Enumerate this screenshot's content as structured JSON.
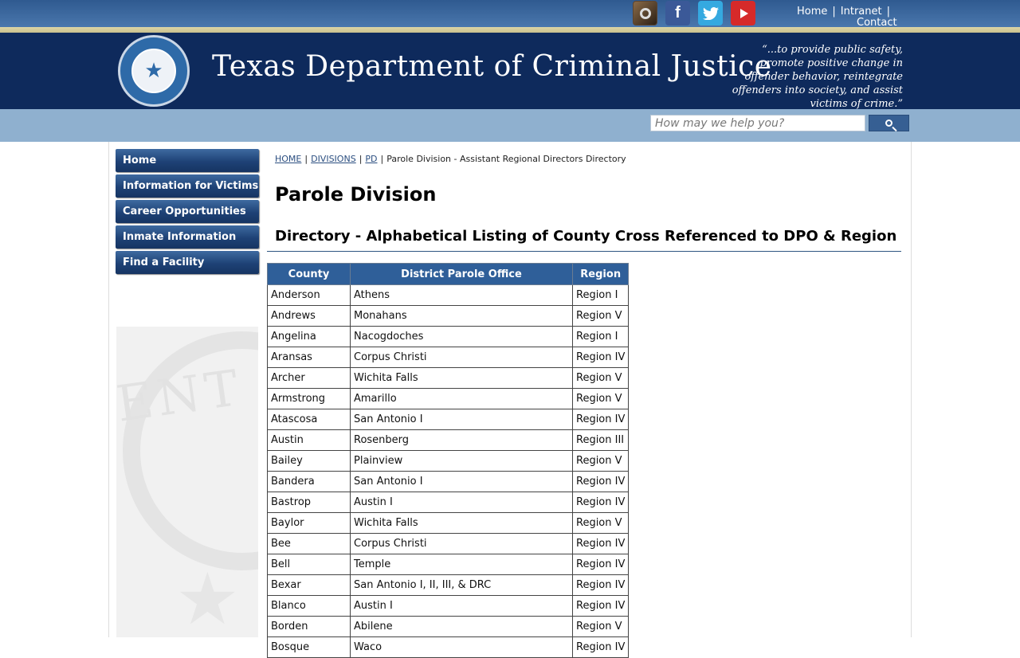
{
  "social": [
    {
      "name": "instagram",
      "icon": "instagram-icon"
    },
    {
      "name": "facebook",
      "icon": "facebook-icon",
      "glyph": "f"
    },
    {
      "name": "twitter",
      "icon": "twitter-icon",
      "glyph": "🐦"
    },
    {
      "name": "youtube",
      "icon": "youtube-icon"
    }
  ],
  "toplinks": {
    "home": "Home",
    "intranet": "Intranet",
    "contact": "Contact",
    "separator": "|"
  },
  "header": {
    "title": "Texas Department of Criminal Justice",
    "motto": "“...to provide public safety, promote positive change in offender behavior, reintegrate offenders into society, and assist victims of crime.”",
    "seal_icon": "tdcj-seal-icon"
  },
  "search": {
    "placeholder": "How may we help you?",
    "button_icon": "search-icon"
  },
  "sidebar": {
    "items": [
      {
        "label": "Home"
      },
      {
        "label": "Information for Victims"
      },
      {
        "label": "Career Opportunities"
      },
      {
        "label": "Inmate Information"
      },
      {
        "label": "Find a Facility"
      }
    ]
  },
  "breadcrumb": {
    "home": "HOME",
    "divisions": "DIVISIONS",
    "pd": "PD",
    "current": "Parole Division - Assistant Regional Directors Directory",
    "separator": "|"
  },
  "main": {
    "title": "Parole Division",
    "section_title": "Directory - Alphabetical Listing of County Cross Referenced to DPO & Region"
  },
  "table": {
    "headers": [
      "County",
      "District Parole Office",
      "Region"
    ],
    "rows": [
      [
        "Anderson",
        "Athens",
        "Region I"
      ],
      [
        "Andrews",
        "Monahans",
        "Region V"
      ],
      [
        "Angelina",
        "Nacogdoches",
        "Region I"
      ],
      [
        "Aransas",
        "Corpus Christi",
        "Region IV"
      ],
      [
        "Archer",
        "Wichita Falls",
        "Region V"
      ],
      [
        "Armstrong",
        "Amarillo",
        "Region V"
      ],
      [
        "Atascosa",
        "San Antonio I",
        "Region IV"
      ],
      [
        "Austin",
        "Rosenberg",
        "Region III"
      ],
      [
        "Bailey",
        "Plainview",
        "Region V"
      ],
      [
        "Bandera",
        "San Antonio I",
        "Region IV"
      ],
      [
        "Bastrop",
        "Austin I",
        "Region IV"
      ],
      [
        "Baylor",
        "Wichita Falls",
        "Region V"
      ],
      [
        "Bee",
        "Corpus Christi",
        "Region IV"
      ],
      [
        "Bell",
        "Temple",
        "Region IV"
      ],
      [
        "Bexar",
        "San Antonio I, II, III, & DRC",
        "Region IV"
      ],
      [
        "Blanco",
        "Austin I",
        "Region IV"
      ],
      [
        "Borden",
        "Abilene",
        "Region V"
      ],
      [
        "Bosque",
        "Waco",
        "Region IV"
      ]
    ]
  },
  "colors": {
    "banner": "#0e2a5c",
    "accent": "#2f5f99",
    "search_strip": "#8fb0cf"
  }
}
